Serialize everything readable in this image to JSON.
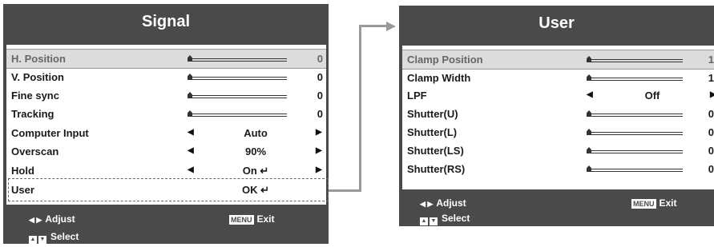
{
  "signal": {
    "title": "Signal",
    "rows": [
      {
        "label": "H. Position",
        "value": "0"
      },
      {
        "label": "V. Position",
        "value": "0"
      },
      {
        "label": "Fine sync",
        "value": "0"
      },
      {
        "label": "Tracking",
        "value": "0"
      },
      {
        "label": "Computer Input",
        "value": "Auto"
      },
      {
        "label": "Overscan",
        "value": "90%"
      },
      {
        "label": "Hold",
        "value": "On ↵"
      },
      {
        "label": "User",
        "value": "OK ↵"
      }
    ],
    "footer": {
      "adjust": "Adjust",
      "select": "Select",
      "menu_key": "MENU",
      "exit": "Exit"
    }
  },
  "user": {
    "title": "User",
    "rows": [
      {
        "label": "Clamp Position",
        "value": "1"
      },
      {
        "label": "Clamp Width",
        "value": "1"
      },
      {
        "label": "LPF",
        "value": "Off"
      },
      {
        "label": "Shutter(U)",
        "value": "0"
      },
      {
        "label": "Shutter(L)",
        "value": "0"
      },
      {
        "label": "Shutter(LS)",
        "value": "0"
      },
      {
        "label": "Shutter(RS)",
        "value": "0"
      }
    ],
    "footer": {
      "adjust": "Adjust",
      "select": "Select",
      "menu_key": "MENU",
      "exit": "Exit"
    }
  }
}
